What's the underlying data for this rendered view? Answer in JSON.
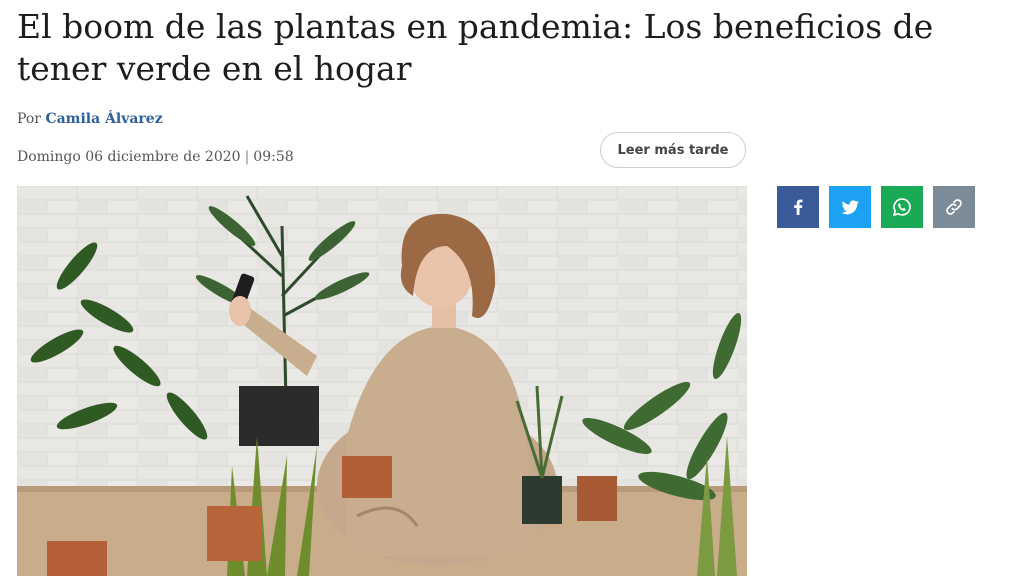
{
  "article": {
    "headline": "El boom de las plantas en pandemia: Los beneficios de tener verde en el hogar",
    "byline_prefix": "Por",
    "author": "Camila Álvarez",
    "date": "Domingo 06 diciembre de 2020",
    "separator": "|",
    "time": "09:58",
    "read_later_label": "Leer más tarde"
  },
  "share": [
    {
      "icon": "facebook-icon",
      "color": "#3b5a9a"
    },
    {
      "icon": "twitter-icon",
      "color": "#1da1f2"
    },
    {
      "icon": "whatsapp-icon",
      "color": "#1aaa55"
    },
    {
      "icon": "link-icon",
      "color": "#7b8b98"
    }
  ],
  "hero_image": {
    "subject": "woman taking a selfie surrounded by houseplants"
  }
}
